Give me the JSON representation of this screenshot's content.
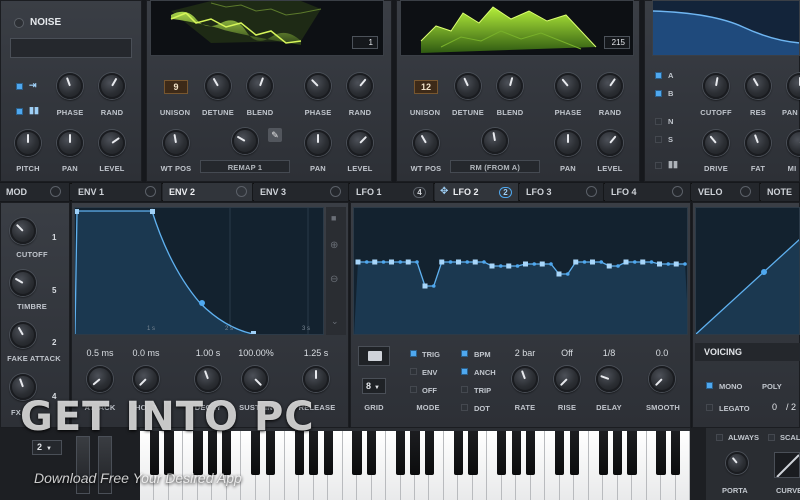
{
  "colors": {
    "accent": "#4fa8ef",
    "background": "#16181c",
    "panel": "#33363c",
    "graph_fill": "#1b3850"
  },
  "noise": {
    "title": "NOISE",
    "preset_field": "",
    "knobs": {
      "phase": "PHASE",
      "rand": "RAND",
      "pitch": "PITCH",
      "pan": "PAN",
      "level": "LEVEL"
    }
  },
  "osc_a": {
    "frame": "1",
    "unison": "9",
    "labels": {
      "unison": "UNISON",
      "detune": "DETUNE",
      "blend": "BLEND",
      "phase": "PHASE",
      "rand": "RAND",
      "wtpos": "WT POS",
      "remap": "REMAP 1",
      "pan": "PAN",
      "level": "LEVEL"
    }
  },
  "osc_b": {
    "frame": "215",
    "unison": "12",
    "labels": {
      "unison": "UNISON",
      "detune": "DETUNE",
      "blend": "BLEND",
      "phase": "PHASE",
      "rand": "RAND",
      "wtpos": "WT POS",
      "remap": "RM (FROM A)",
      "pan": "PAN",
      "level": "LEVEL"
    }
  },
  "filter": {
    "toggles": {
      "a": "A",
      "b": "B",
      "n": "N",
      "s": "S"
    },
    "labels": {
      "cutoff": "CUTOFF",
      "res": "RES",
      "pan": "PAN",
      "drive": "DRIVE",
      "fat": "FAT",
      "mix": "MI"
    }
  },
  "mod_tabs": {
    "mod": "MOD",
    "env1": "ENV 1",
    "env2": "ENV 2",
    "env3": "ENV 3",
    "lfo1": "LFO 1",
    "lfo1_count": "4",
    "lfo2": "LFO 2",
    "lfo2_count": "2",
    "lfo3": "LFO 3",
    "lfo4": "LFO 4",
    "velo": "VELO",
    "note": "NOTE"
  },
  "mod_sources": [
    {
      "label": "CUTOFF",
      "count": "1"
    },
    {
      "label": "TIMBRE",
      "count": "5"
    },
    {
      "label": "FAKE ATTACK",
      "count": "2"
    },
    {
      "label": "FX",
      "count": "4"
    }
  ],
  "env2": {
    "markers": [
      "1 s",
      "2 s",
      "3 s"
    ],
    "params": [
      {
        "value": "0.5 ms",
        "label": "ATTACK"
      },
      {
        "value": "0.0 ms",
        "label": "HOLD"
      },
      {
        "value": "1.00 s",
        "label": "DECAY"
      },
      {
        "value": "100.00%",
        "label": "SUSTAIN"
      },
      {
        "value": "1.25 s",
        "label": "RELEASE"
      }
    ]
  },
  "lfo2": {
    "grid_value": "8",
    "grid_label": "GRID",
    "mode_label": "MODE",
    "modes": {
      "trig": "TRIG",
      "env": "ENV",
      "off": "OFF"
    },
    "flags": {
      "bpm": "BPM",
      "anch": "ANCH",
      "trip": "TRIP",
      "dot": "DOT"
    },
    "params": [
      {
        "value": "2 bar",
        "label": "RATE"
      },
      {
        "value": "Off",
        "label": "RISE"
      },
      {
        "value": "1/8",
        "label": "DELAY"
      },
      {
        "value": "0.0",
        "label": "SMOOTH"
      }
    ]
  },
  "voicing": {
    "title": "VOICING",
    "mono": "MONO",
    "poly": "POLY",
    "legato": "LEGATO",
    "legato_value": "0",
    "poly_value": "/ 2"
  },
  "bottom": {
    "octave": "2",
    "always": "ALWAYS",
    "scale": "SCALE",
    "porta": "PORTA",
    "curve": "CURVE"
  },
  "watermark": {
    "brand": "GET INTO PC",
    "tagline": "Download Free Your Desired App"
  }
}
